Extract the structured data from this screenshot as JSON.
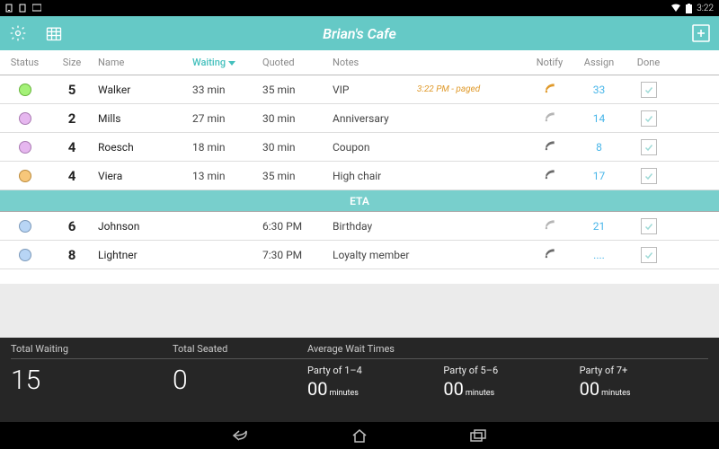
{
  "statusbar": {
    "clock": "3:22"
  },
  "header": {
    "title": "Brian's Cafe"
  },
  "columns": {
    "status": "Status",
    "size": "Size",
    "name": "Name",
    "waiting": "Waiting",
    "quoted": "Quoted",
    "notes": "Notes",
    "notify": "Notify",
    "assign": "Assign",
    "done": "Done"
  },
  "sections": {
    "eta": "ETA"
  },
  "rows": [
    {
      "status_color": "#a4f178",
      "size": "5",
      "name": "Walker",
      "waiting": "33 min",
      "quoted": "35 min",
      "notes": "VIP",
      "status_text": "3:22 PM - paged",
      "notify_active": true,
      "assign": "33"
    },
    {
      "status_color": "#e6b7ef",
      "size": "2",
      "name": "Mills",
      "waiting": "27 min",
      "quoted": "30 min",
      "notes": "Anniversary",
      "status_text": "",
      "notify_active": false,
      "assign": "14"
    },
    {
      "status_color": "#e6b7ef",
      "size": "4",
      "name": "Roesch",
      "waiting": "18 min",
      "quoted": "30 min",
      "notes": "Coupon",
      "status_text": "",
      "notify_active": true,
      "assign": "8"
    },
    {
      "status_color": "#f7c77a",
      "size": "4",
      "name": "Viera",
      "waiting": "13 min",
      "quoted": "35 min",
      "notes": "High chair",
      "status_text": "",
      "notify_active": true,
      "assign": "17"
    }
  ],
  "eta_rows": [
    {
      "status_color": "#b8d5f5",
      "size": "6",
      "name": "Johnson",
      "waiting": "",
      "quoted": "6:30 PM",
      "notes": "Birthday",
      "status_text": "",
      "notify_active": false,
      "assign": "21"
    },
    {
      "status_color": "#b8d5f5",
      "size": "8",
      "name": "Lightner",
      "waiting": "",
      "quoted": "7:30 PM",
      "notes": "Loyalty member",
      "status_text": "",
      "notify_active": false,
      "assign": "...."
    }
  ],
  "footer": {
    "total_waiting_label": "Total Waiting",
    "total_seated_label": "Total Seated",
    "awt_label": "Average Wait Times",
    "total_waiting": "15",
    "total_seated": "0",
    "buckets": [
      {
        "label": "Party of 1–4",
        "minutes": "00",
        "unit": "minutes"
      },
      {
        "label": "Party of 5–6",
        "minutes": "00",
        "unit": "minutes"
      },
      {
        "label": "Party of 7+",
        "minutes": "00",
        "unit": "minutes"
      }
    ]
  }
}
